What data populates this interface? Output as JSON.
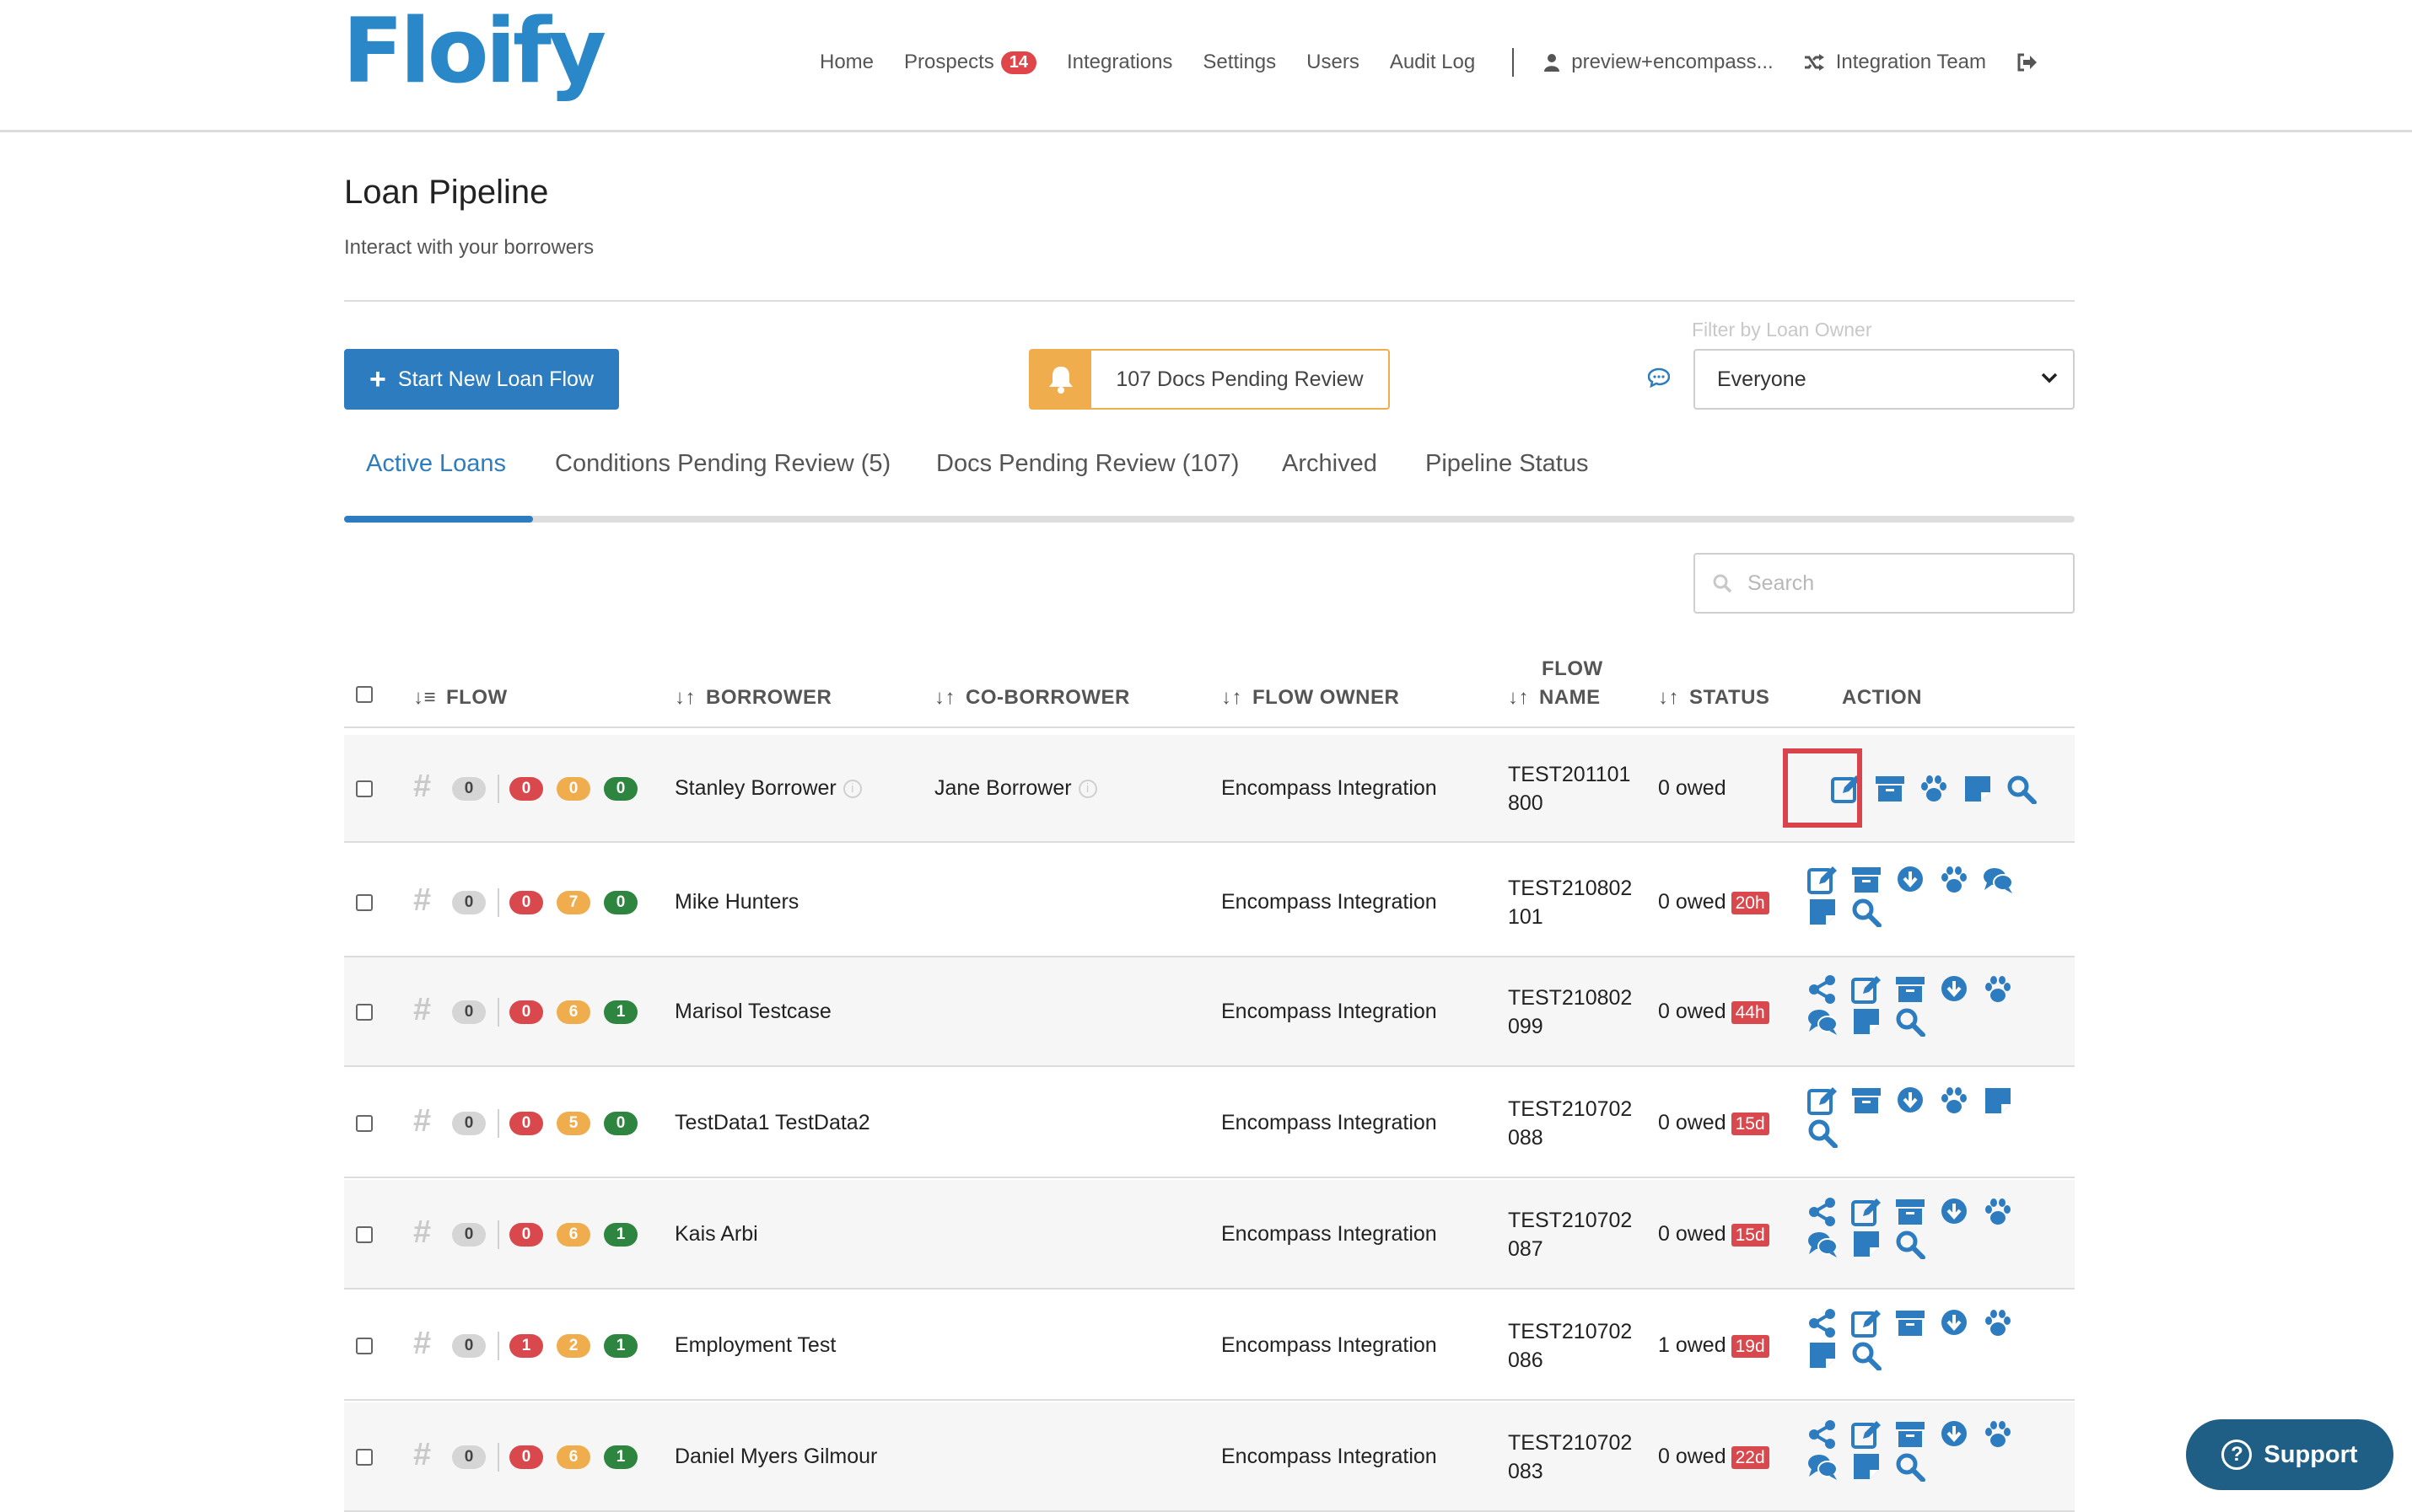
{
  "brand": {
    "logo_text": "Floify",
    "accent": "#2e7cc0",
    "logo_color": "#2a88c9"
  },
  "nav": {
    "home": "Home",
    "prospects": "Prospects",
    "prospects_count": "14",
    "integrations": "Integrations",
    "settings": "Settings",
    "users": "Users",
    "audit_log": "Audit Log",
    "user": "preview+encompass...",
    "team": "Integration Team"
  },
  "page": {
    "title": "Loan Pipeline",
    "subtitle": "Interact with your borrowers"
  },
  "toolbar": {
    "start_label": "Start New Loan Flow",
    "docs_pending_label": "107 Docs Pending Review",
    "filter_label": "Filter by Loan Owner",
    "filter_value": "Everyone"
  },
  "tabs": [
    {
      "label": "Active Loans",
      "active": true
    },
    {
      "label": "Conditions Pending Review (5)"
    },
    {
      "label": "Docs Pending Review (107)"
    },
    {
      "label": "Archived"
    },
    {
      "label": "Pipeline Status"
    }
  ],
  "search": {
    "placeholder": "Search"
  },
  "table": {
    "headers": {
      "flow": "FLOW",
      "borrower": "BORROWER",
      "coborrower": "CO-BORROWER",
      "owner": "FLOW OWNER",
      "flow_name_1": "FLOW",
      "flow_name_2": "NAME",
      "status": "STATUS",
      "action": "ACTION"
    },
    "rows": [
      {
        "c0": "0",
        "c1": "0",
        "c2": "0",
        "c3": "0",
        "borrower": "Stanley Borrower",
        "coborrower": "Jane Borrower",
        "owner": "Encompass Integration",
        "flow1": "TEST201101",
        "flow2": "800",
        "owed": "0 owed",
        "age": "",
        "icons": [
          "edit-icon",
          "archive-icon",
          "paw-icon",
          "note-icon",
          "search-icon"
        ]
      },
      {
        "c0": "0",
        "c1": "0",
        "c2": "7",
        "c3": "0",
        "borrower": "Mike Hunters",
        "coborrower": "",
        "owner": "Encompass Integration",
        "flow1": "TEST210802",
        "flow2": "101",
        "owed": "0 owed",
        "age": "20h",
        "icons": [
          "edit-icon",
          "archive-icon",
          "download-icon",
          "paw-icon",
          "comments-icon",
          "note-icon",
          "search-icon"
        ]
      },
      {
        "c0": "0",
        "c1": "0",
        "c2": "6",
        "c3": "1",
        "borrower": "Marisol Testcase",
        "coborrower": "",
        "owner": "Encompass Integration",
        "flow1": "TEST210802",
        "flow2": "099",
        "owed": "0 owed",
        "age": "44h",
        "icons": [
          "share-icon",
          "edit-icon",
          "archive-icon",
          "download-icon",
          "paw-icon",
          "comments-icon",
          "note-icon",
          "search-icon"
        ]
      },
      {
        "c0": "0",
        "c1": "0",
        "c2": "5",
        "c3": "0",
        "borrower": "TestData1 TestData2",
        "coborrower": "",
        "owner": "Encompass Integration",
        "flow1": "TEST210702",
        "flow2": "088",
        "owed": "0 owed",
        "age": "15d",
        "icons": [
          "edit-icon",
          "archive-icon",
          "download-icon",
          "paw-icon",
          "note-icon",
          "search-icon"
        ]
      },
      {
        "c0": "0",
        "c1": "0",
        "c2": "6",
        "c3": "1",
        "borrower": "Kais Arbi",
        "coborrower": "",
        "owner": "Encompass Integration",
        "flow1": "TEST210702",
        "flow2": "087",
        "owed": "0 owed",
        "age": "15d",
        "icons": [
          "share-icon",
          "edit-icon",
          "archive-icon",
          "download-icon",
          "paw-icon",
          "comments-icon",
          "note-icon",
          "search-icon"
        ]
      },
      {
        "c0": "0",
        "c1": "1",
        "c2": "2",
        "c3": "1",
        "borrower": "Employment Test",
        "coborrower": "",
        "owner": "Encompass Integration",
        "flow1": "TEST210702",
        "flow2": "086",
        "owed": "1 owed",
        "age": "19d",
        "icons": [
          "share-icon",
          "edit-icon",
          "archive-icon",
          "download-icon",
          "paw-icon",
          "note-icon",
          "search-icon"
        ]
      },
      {
        "c0": "0",
        "c1": "0",
        "c2": "6",
        "c3": "1",
        "borrower": "Daniel Myers Gilmour",
        "coborrower": "",
        "owner": "Encompass Integration",
        "flow1": "TEST210702",
        "flow2": "083",
        "owed": "0 owed",
        "age": "22d",
        "icons": [
          "share-icon",
          "edit-icon",
          "archive-icon",
          "download-icon",
          "paw-icon",
          "comments-icon",
          "note-icon",
          "search-icon"
        ]
      }
    ]
  },
  "support": {
    "label": "Support"
  }
}
